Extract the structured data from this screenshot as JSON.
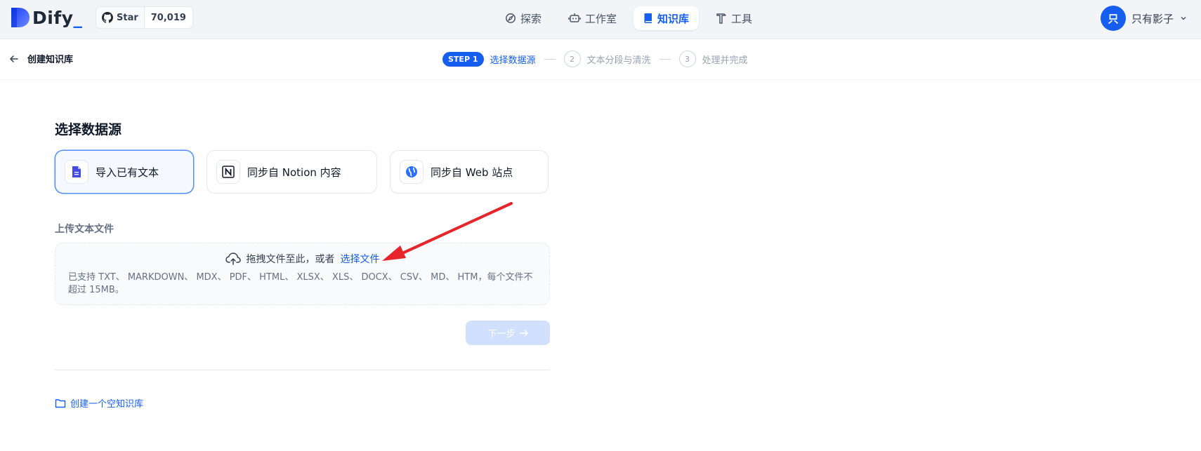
{
  "header": {
    "logo_text": "Dify",
    "logo_underscore": "_",
    "github": {
      "star_label": "Star",
      "count": "70,019"
    },
    "nav": [
      {
        "label": "探索",
        "icon": "compass-icon",
        "active": false
      },
      {
        "label": "工作室",
        "icon": "robot-icon",
        "active": false
      },
      {
        "label": "知识库",
        "icon": "book-icon",
        "active": true
      },
      {
        "label": "工具",
        "icon": "hammer-icon",
        "active": false
      }
    ],
    "user": {
      "avatar_letter": "只",
      "name": "只有影子"
    }
  },
  "subheader": {
    "back_label": "创建知识库",
    "steps": [
      {
        "badge": "STEP 1",
        "label": "选择数据源",
        "active": true
      },
      {
        "number": "2",
        "label": "文本分段与清洗",
        "active": false
      },
      {
        "number": "3",
        "label": "处理并完成",
        "active": false
      }
    ]
  },
  "main": {
    "title": "选择数据源",
    "sources": [
      {
        "label": "导入已有文本",
        "icon": "file-icon",
        "active": true
      },
      {
        "label": "同步自 Notion 内容",
        "icon": "notion-icon",
        "active": false
      },
      {
        "label": "同步自 Web 站点",
        "icon": "globe-icon",
        "active": false
      }
    ],
    "upload": {
      "title": "上传文本文件",
      "drop_text": "拖拽文件至此，或者",
      "choose_link": "选择文件",
      "hint": "已支持 TXT、 MARKDOWN、 MDX、 PDF、 HTML、 XLSX、 XLS、 DOCX、 CSV、 MD、 HTM，每个文件不超过 15MB。"
    },
    "next_button": "下一步",
    "empty_link": "创建一个空知识库"
  },
  "colors": {
    "accent": "#155eef",
    "annotation_arrow": "#e5252a"
  }
}
